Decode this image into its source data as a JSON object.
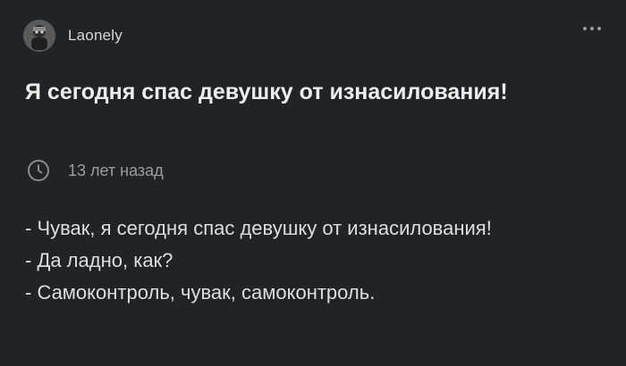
{
  "post": {
    "author": "Laonely",
    "title": "Я сегодня спас девушку от изнасилования!",
    "time": "13 лет назад",
    "body": [
      "- Чувак, я сегодня спас девушку от изнасилования!",
      "- Да ладно, как?",
      "- Самоконтроль, чувак, самоконтроль."
    ]
  },
  "icons": {
    "more": "more-horizontal-icon",
    "clock": "clock-icon"
  }
}
